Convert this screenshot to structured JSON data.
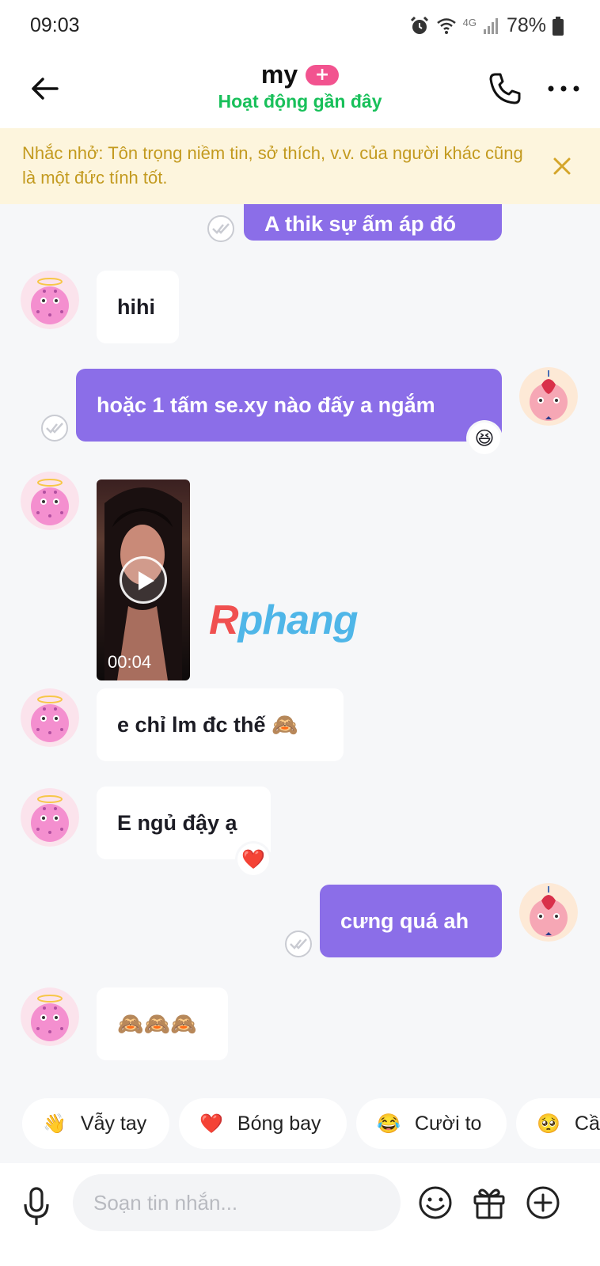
{
  "status_bar": {
    "time": "09:03",
    "network": "4G",
    "battery": "78%"
  },
  "header": {
    "title": "my",
    "badge": "+",
    "subtitle": "Hoạt động gần đây",
    "icons": [
      "back-arrow-icon",
      "phone-icon",
      "more-icon"
    ]
  },
  "reminder": {
    "text": "Nhắc nhở: Tôn trọng niềm tin, sở thích, v.v. của người khác cũng là một đức tính tốt."
  },
  "messages": [
    {
      "side": "out",
      "text": "A thik sự ấm áp đó"
    },
    {
      "side": "in",
      "text": "hihi"
    },
    {
      "side": "out",
      "text": "hoặc 1 tấm se.xy nào đấy a ngắm",
      "reaction": "😆"
    },
    {
      "side": "in",
      "type": "video",
      "duration": "00:04"
    },
    {
      "side": "in",
      "text": "e chỉ lm đc thế 🙈"
    },
    {
      "side": "in",
      "text": "E ngủ đậy ạ",
      "reaction": "❤️"
    },
    {
      "side": "out",
      "text": "cưng quá ah"
    },
    {
      "side": "in",
      "text": "🙈🙈🙈"
    }
  ],
  "watermark": {
    "first": "R",
    "rest": "phang"
  },
  "quick_replies": [
    {
      "emoji": "👋",
      "label": "Vẫy tay"
    },
    {
      "emoji": "❤️",
      "label": "Bóng bay"
    },
    {
      "emoji": "😂",
      "label": "Cười to"
    },
    {
      "emoji": "🥺",
      "label": "Cầ"
    }
  ],
  "composer": {
    "placeholder": "Soạn tin nhắn..."
  },
  "colors": {
    "outgoing_bubble": "#8b6ee8",
    "subtitle_green": "#18c05a",
    "reminder_bg": "#fdf5dd",
    "reminder_text": "#c39a1f",
    "badge_pink": "#f2538f"
  }
}
